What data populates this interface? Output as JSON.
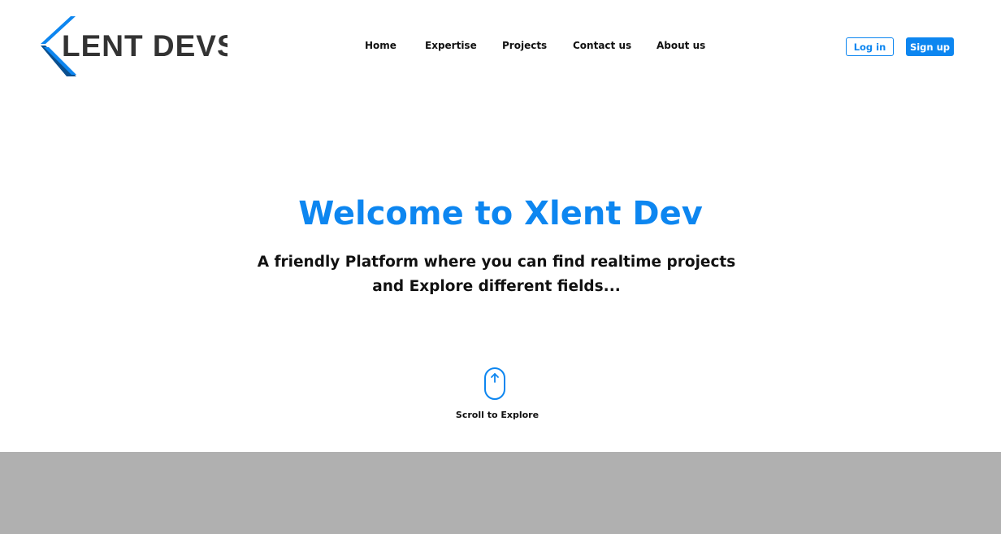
{
  "brand": {
    "logo_text": "XLENT DEVS",
    "logo_x_color": "#0d86f0",
    "logo_x_dark_color": "#0a4f8f",
    "logo_text_color": "#333333"
  },
  "nav": {
    "items": [
      {
        "label": "Home"
      },
      {
        "label": "Expertise"
      },
      {
        "label": "Projects"
      },
      {
        "label": "Contact us"
      },
      {
        "label": "About us"
      }
    ]
  },
  "auth": {
    "login_label": "Log in",
    "signup_label": "Sign up"
  },
  "hero": {
    "title": "Welcome to Xlent Dev",
    "subtitle": "A friendly Platform where you can find realtime projects and Explore different fields..."
  },
  "scroll": {
    "icon": "mouse-scroll-icon",
    "label": "Scroll to Explore"
  },
  "colors": {
    "accent": "#0d86f0",
    "band": "#b0b0b0",
    "text": "#111111"
  }
}
